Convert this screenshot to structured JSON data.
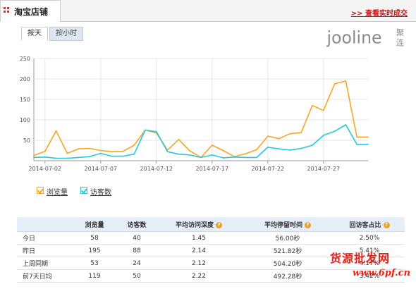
{
  "header": {
    "shop_title": "淘宝店铺",
    "realtime_link": ">> 查看实时成交"
  },
  "tabs": [
    {
      "label": "按天",
      "active": true
    },
    {
      "label": "按小时",
      "active": false
    }
  ],
  "logo": {
    "text": "jooline",
    "cn": "聚连",
    "color": "#8a8a8a"
  },
  "legend": [
    {
      "label": "浏览量",
      "color": "#f5a623"
    },
    {
      "label": "访客数",
      "color": "#29c7d8"
    }
  ],
  "chart_data": {
    "type": "line",
    "ylim": [
      0,
      250
    ],
    "yticks": [
      50,
      100,
      150,
      200,
      250
    ],
    "xtick_labels": [
      "2014-07-02",
      "2014-07-07",
      "2014-07-12",
      "2014-07-17",
      "2014-07-22",
      "2014-07-27"
    ],
    "x": [
      "2014-07-01",
      "2014-07-02",
      "2014-07-03",
      "2014-07-04",
      "2014-07-05",
      "2014-07-06",
      "2014-07-07",
      "2014-07-08",
      "2014-07-09",
      "2014-07-10",
      "2014-07-11",
      "2014-07-12",
      "2014-07-13",
      "2014-07-14",
      "2014-07-15",
      "2014-07-16",
      "2014-07-17",
      "2014-07-18",
      "2014-07-19",
      "2014-07-20",
      "2014-07-21",
      "2014-07-22",
      "2014-07-23",
      "2014-07-24",
      "2014-07-25",
      "2014-07-26",
      "2014-07-27",
      "2014-07-28",
      "2014-07-29",
      "2014-07-30",
      "2014-07-31"
    ],
    "series": [
      {
        "name": "浏览量",
        "color": "#f5a623",
        "values": [
          13,
          23,
          73,
          18,
          29,
          30,
          25,
          22,
          23,
          38,
          75,
          68,
          26,
          52,
          24,
          8,
          38,
          25,
          10,
          17,
          27,
          60,
          54,
          66,
          69,
          135,
          123,
          188,
          195,
          58,
          58
        ]
      },
      {
        "name": "访客数",
        "color": "#29c7d8",
        "values": [
          8,
          9,
          6,
          6,
          8,
          10,
          18,
          11,
          11,
          16,
          75,
          71,
          22,
          16,
          14,
          8,
          14,
          7,
          9,
          8,
          8,
          33,
          29,
          26,
          30,
          38,
          62,
          72,
          88,
          40,
          40
        ]
      }
    ],
    "grid": true
  },
  "table": {
    "headers": [
      "",
      "浏览量",
      "访客数",
      "平均访问深度",
      "平均停留时间",
      "回访客占比"
    ],
    "header_help": [
      false,
      false,
      false,
      true,
      true,
      true
    ],
    "rows": [
      [
        "今日",
        "58",
        "40",
        "1.45",
        "56.00秒",
        "2.50%"
      ],
      [
        "昨日",
        "195",
        "88",
        "2.14",
        "521.82秒",
        "5.41%"
      ],
      [
        "上周同期",
        "53",
        "24",
        "2.12",
        "504.20秒",
        "4.17%"
      ],
      [
        "前7天日均",
        "119",
        "50",
        "2.22",
        "492.28秒",
        "3.42%"
      ]
    ]
  },
  "watermark": {
    "brand": "货源批发网",
    "url": "www.6pf.cn"
  }
}
